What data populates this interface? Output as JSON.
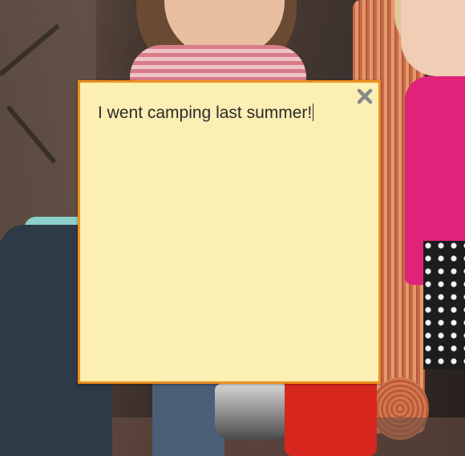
{
  "note": {
    "text": "I went camping last summer!",
    "border_color": "#f0921f",
    "background_color": "#fcefb4",
    "close_icon": "close-icon"
  },
  "background": {
    "description_icon": "photo-background"
  }
}
